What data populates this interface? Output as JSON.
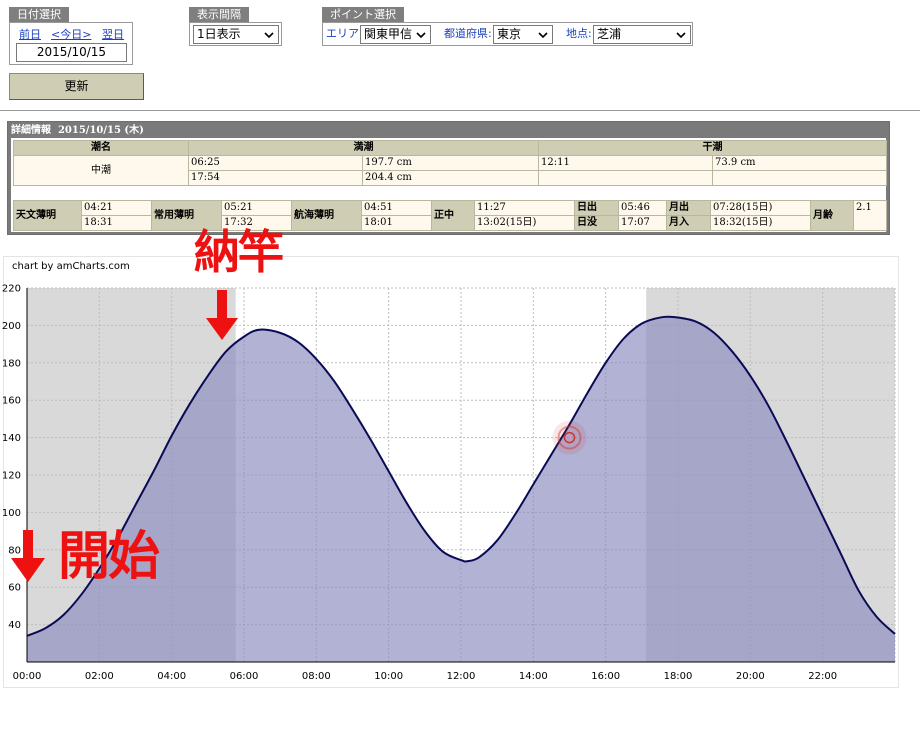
{
  "date_group": {
    "tab": "日付選択",
    "prev": "前日",
    "today": "<今日>",
    "next": "翌日",
    "date": "2015/10/15"
  },
  "interval_group": {
    "tab": "表示間隔",
    "value": "1日表示"
  },
  "point_group": {
    "tab": "ポイント選択",
    "area_label": "エリア:",
    "area_value": "関東甲信",
    "pref_label": "都道府県:",
    "pref_value": "東京",
    "place_label": "地点:",
    "place_value": "芝浦"
  },
  "update_button": "更新",
  "detail": {
    "title": "詳細情報",
    "date": "2015/10/15 (木)",
    "headers": [
      "潮名",
      "満潮",
      "干潮"
    ],
    "tide_name": "中潮",
    "high": [
      {
        "time": "06:25",
        "height": "197.7 cm"
      },
      {
        "time": "17:54",
        "height": "204.4 cm"
      }
    ],
    "low": [
      {
        "time": "12:11",
        "height": "73.9 cm"
      },
      {
        "time": "",
        "height": ""
      }
    ],
    "astro": {
      "astronomical_twilight": {
        "label": "天文薄明",
        "v1": "04:21",
        "v2": "18:31"
      },
      "civil_twilight": {
        "label": "常用薄明",
        "v1": "05:21",
        "v2": "17:32"
      },
      "nautical_twilight": {
        "label": "航海薄明",
        "v1": "04:51",
        "v2": "18:01"
      },
      "noon": {
        "label": "正中",
        "v1": "11:27",
        "v2": "13:02(15日)"
      },
      "sunrise": {
        "label": "日出",
        "v": "05:46"
      },
      "sunset": {
        "label": "日没",
        "v": "17:07"
      },
      "moonrise": {
        "label": "月出",
        "v": "07:28(15日)"
      },
      "moonset": {
        "label": "月入",
        "v": "18:32(15日)"
      },
      "moon_age": {
        "label": "月齢",
        "v": "2.1"
      }
    }
  },
  "chart_credit": "chart by amCharts.com",
  "annotations": {
    "top": "納竿",
    "left": "開始"
  },
  "colors": {
    "fill": "#8e8ec0",
    "line": "#0b0b55",
    "night": "#d9d9d9",
    "annotation": "#ee1111",
    "marker": "#cc3333"
  },
  "chart_data": {
    "type": "area",
    "title": "",
    "xlabel": "",
    "ylabel": "",
    "x_ticks": [
      "00:00",
      "02:00",
      "04:00",
      "06:00",
      "08:00",
      "10:00",
      "12:00",
      "14:00",
      "16:00",
      "18:00",
      "20:00",
      "22:00"
    ],
    "y_ticks": [
      40,
      60,
      80,
      100,
      120,
      140,
      160,
      180,
      200,
      220
    ],
    "xlim_hours": [
      0,
      24
    ],
    "ylim": [
      20,
      220
    ],
    "grid": true,
    "night_bands_hours": [
      [
        0,
        5.77
      ],
      [
        17.12,
        24
      ]
    ],
    "series": [
      {
        "name": "",
        "x_hours": [
          0,
          0.5,
          1,
          1.5,
          2,
          2.5,
          3,
          3.5,
          4,
          4.5,
          5,
          5.5,
          6,
          6.42,
          7,
          7.5,
          8,
          8.5,
          9,
          9.5,
          10,
          10.5,
          11,
          11.5,
          12,
          12.18,
          12.5,
          13,
          13.5,
          14,
          14.5,
          15,
          15.5,
          16,
          16.5,
          17,
          17.5,
          17.9,
          18.5,
          19,
          19.5,
          20,
          20.5,
          21,
          21.5,
          22,
          22.5,
          23,
          23.5,
          24
        ],
        "values": [
          34,
          38,
          45,
          56,
          70,
          86,
          104,
          122,
          141,
          158,
          173,
          186,
          194,
          197.7,
          196,
          191,
          182,
          170,
          155,
          139,
          122,
          105,
          90,
          79,
          74.5,
          73.9,
          76,
          85,
          99,
          115,
          131,
          147,
          164,
          180,
          193,
          201,
          204.2,
          204.4,
          202,
          196,
          186,
          173,
          157,
          138,
          118,
          98,
          78,
          58,
          44,
          35
        ]
      }
    ],
    "marker": {
      "x_hours": 15,
      "y": 140
    }
  }
}
